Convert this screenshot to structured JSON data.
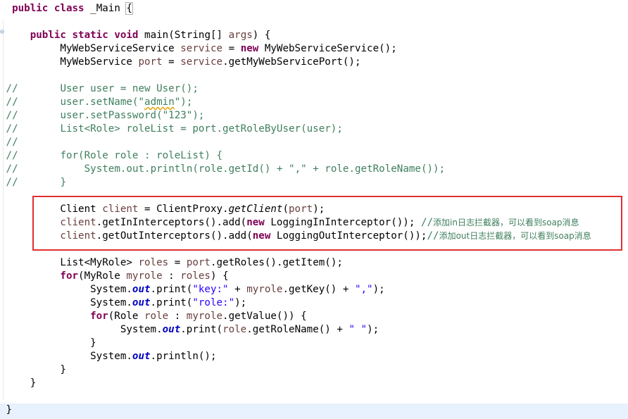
{
  "code": {
    "l1": {
      "kw1": "public",
      "kw2": "class",
      "name": " _Main ",
      "brace": "{"
    },
    "l3": {
      "kw1": "public",
      "kw2": "static",
      "kw3": "void",
      "rest": " main(String[] ",
      "arg": "args",
      "end": ") {"
    },
    "l4": {
      "t1": "MyWebServiceService ",
      "v": "service",
      "t2": " = ",
      "kw": "new",
      "t3": " MyWebServiceService();"
    },
    "l5": {
      "t1": "MyWebService ",
      "v": "port",
      "t2": " = ",
      "v2": "service",
      "t3": ".getMyWebServicePort();"
    },
    "l7": {
      "c1": "//",
      "c2": "User user = new User();"
    },
    "l8": {
      "c1": "//",
      "c2a": "user.setName(\"",
      "c2b": "admin",
      "c2c": "\");"
    },
    "l9": {
      "c1": "//",
      "c2": "user.setPassword(\"123\");"
    },
    "l10": {
      "c1": "//",
      "c2": "List<Role> roleList = port.getRoleByUser(user);"
    },
    "l11": {
      "c1": "//"
    },
    "l12": {
      "c1": "//",
      "c2": "for(Role role : roleList) {"
    },
    "l13": {
      "c1": "//",
      "c2": "System.out.println(role.getId() + \",\" + role.getRoleName());"
    },
    "l14": {
      "c1": "//",
      "c2": "}"
    },
    "l16": {
      "t1": "Client ",
      "v": "client",
      "t2": " = ClientProxy.",
      "m": "getClient",
      "t3": "(",
      "v2": "port",
      "t4": ");"
    },
    "l17": {
      "v": "client",
      "t1": ".getInInterceptors().add(",
      "kw": "new",
      "t2": " LoggingInInterceptor()); ",
      "cm": "//",
      "cm2": "添加in日志拦截器，可以看到soap消息"
    },
    "l18": {
      "v": "client",
      "t1": ".getOutInterceptors().add(",
      "kw": "new",
      "t2": " LoggingOutInterceptor());",
      "cm": "//",
      "cm2": "添加out日志拦截器，可以看到soap消息"
    },
    "l20": {
      "t1": "List<MyRole> ",
      "v": "roles",
      "t2": " = ",
      "v2": "port",
      "t3": ".getRoles().getItem();"
    },
    "l21": {
      "kw": "for",
      "t1": "(MyRole ",
      "v": "myrole",
      "t2": " : ",
      "v2": "roles",
      "t3": ") {"
    },
    "l22": {
      "t1": "System.",
      "f": "out",
      "t2": ".print(",
      "s": "\"key:\"",
      "t3": " + ",
      "v": "myrole",
      "t4": ".getKey() + ",
      "s2": "\",\"",
      "t5": ");"
    },
    "l23": {
      "t1": "System.",
      "f": "out",
      "t2": ".print(",
      "s": "\"role:\"",
      "t3": ");"
    },
    "l24": {
      "kw": "for",
      "t1": "(Role ",
      "v": "role",
      "t2": " : ",
      "v2": "myrole",
      "t3": ".getValue()) {"
    },
    "l25": {
      "t1": "System.",
      "f": "out",
      "t2": ".print(",
      "v": "role",
      "t3": ".getRoleName() + ",
      "s": "\" \"",
      "t4": ");"
    },
    "l26": {
      "t": "}"
    },
    "l27": {
      "t1": "System.",
      "f": "out",
      "t2": ".println();"
    },
    "l28": {
      "t": "}"
    },
    "l29": {
      "t": "}"
    },
    "l31": {
      "t": "}"
    }
  },
  "colors": {
    "keyword": "#7f0055",
    "local_variable": "#6a3e3e",
    "string": "#2a00ff",
    "static_field": "#0000c0",
    "comment": "#3f7f5f",
    "highlight_box": "#e0302f",
    "current_line": "#e8f2fe"
  }
}
